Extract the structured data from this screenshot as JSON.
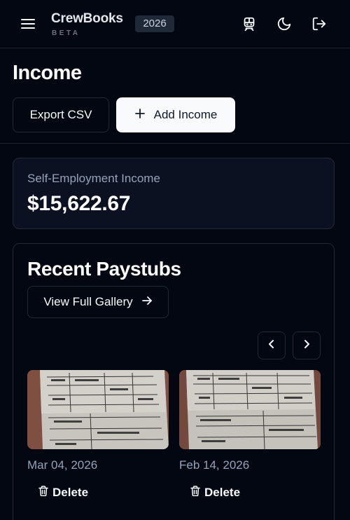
{
  "header": {
    "brand": "CrewBooks",
    "brand_sub": "BETA",
    "year": "2026",
    "icons": [
      "menu-icon",
      "train-icon",
      "moon-icon",
      "logout-icon"
    ]
  },
  "page": {
    "title": "Income",
    "export_label": "Export CSV",
    "add_label": "Add Income"
  },
  "stat": {
    "label": "Self-Employment Income",
    "value": "$15,622.67"
  },
  "paystubs": {
    "title": "Recent Paystubs",
    "gallery_label": "View Full Gallery",
    "items": [
      {
        "date": "Mar 04, 2026",
        "delete_label": "Delete"
      },
      {
        "date": "Feb 14, 2026",
        "delete_label": "Delete"
      }
    ]
  },
  "colors": {
    "background": "#030712",
    "card": "#0b1120",
    "border": "#1f2937",
    "muted_text": "#94a3b8",
    "primary_button": "#f8fafc"
  }
}
